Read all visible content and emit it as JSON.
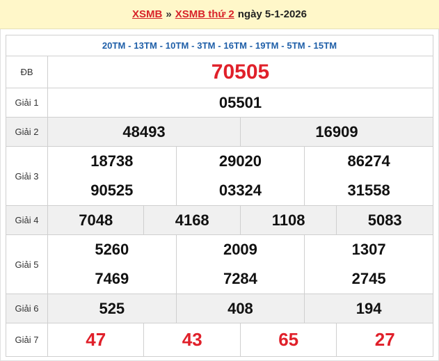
{
  "header": {
    "link1": "XSMB",
    "separator": "»",
    "link2": "XSMB thứ 2",
    "date": "ngày 5-1-2026"
  },
  "mags": "20TM - 13TM - 10TM - 3TM - 16TM - 19TM - 5TM - 15TM",
  "labels": {
    "db": "ĐB",
    "g1": "Giải 1",
    "g2": "Giải 2",
    "g3": "Giải 3",
    "g4": "Giải 4",
    "g5": "Giải 5",
    "g6": "Giải 6",
    "g7": "Giải 7"
  },
  "prizes": {
    "db": "70505",
    "g1": "05501",
    "g2": [
      "48493",
      "16909"
    ],
    "g3": [
      "18738",
      "29020",
      "86274",
      "90525",
      "03324",
      "31558"
    ],
    "g4": [
      "7048",
      "4168",
      "1108",
      "5083"
    ],
    "g5": [
      "5260",
      "2009",
      "1307",
      "7469",
      "7284",
      "2745"
    ],
    "g6": [
      "525",
      "408",
      "194"
    ],
    "g7": [
      "47",
      "43",
      "65",
      "27"
    ]
  },
  "colors": {
    "accent_red": "#e0202a",
    "link_red": "#d8232a",
    "mag_blue": "#1f5fa8",
    "header_bg": "#fff7c9"
  }
}
